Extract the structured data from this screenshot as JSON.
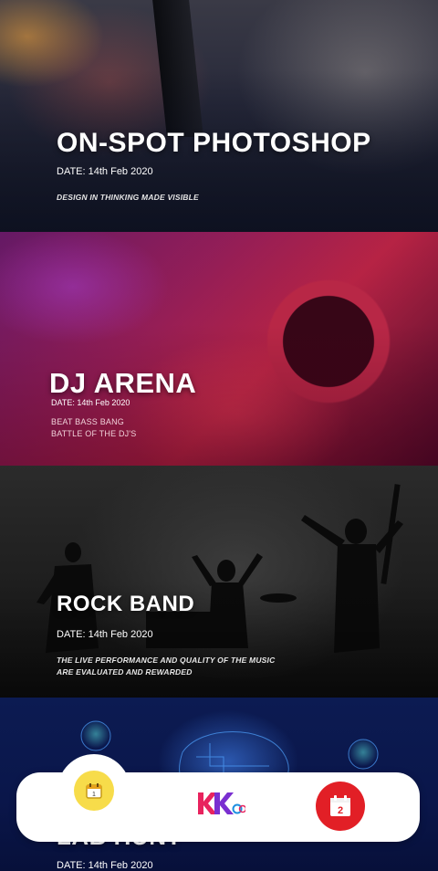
{
  "events": [
    {
      "title": "ON-SPOT PHOTOSHOP",
      "date": "DATE: 14th Feb 2020",
      "subtitle_lines": [
        "DESIGN IN THINKING MADE VISIBLE"
      ]
    },
    {
      "title": "DJ ARENA",
      "date": "DATE: 14th Feb 2020",
      "subtitle_lines": [
        "BEAT BASS BANG",
        "BATTLE OF THE DJ'S"
      ]
    },
    {
      "title": "ROCK BAND",
      "date": "DATE: 14th Feb 2020",
      "subtitle_lines": [
        "THE LIVE PERFORMANCE AND QUALITY OF THE MUSIC",
        "ARE EVALUATED AND REWARDED"
      ]
    },
    {
      "title": "LAB HUNT",
      "date": "DATE: 14th Feb 2020"
    }
  ],
  "bottom_nav": {
    "items": [
      {
        "icon": "calendar-day-1-icon",
        "badge": "1",
        "active": true,
        "color": "#f7dc4a"
      },
      {
        "icon": "app-logo-icon",
        "logo_text": "KK",
        "color": "#e21f5a"
      },
      {
        "icon": "calendar-day-2-icon",
        "badge": "2",
        "color": "#e21f26"
      }
    ]
  }
}
